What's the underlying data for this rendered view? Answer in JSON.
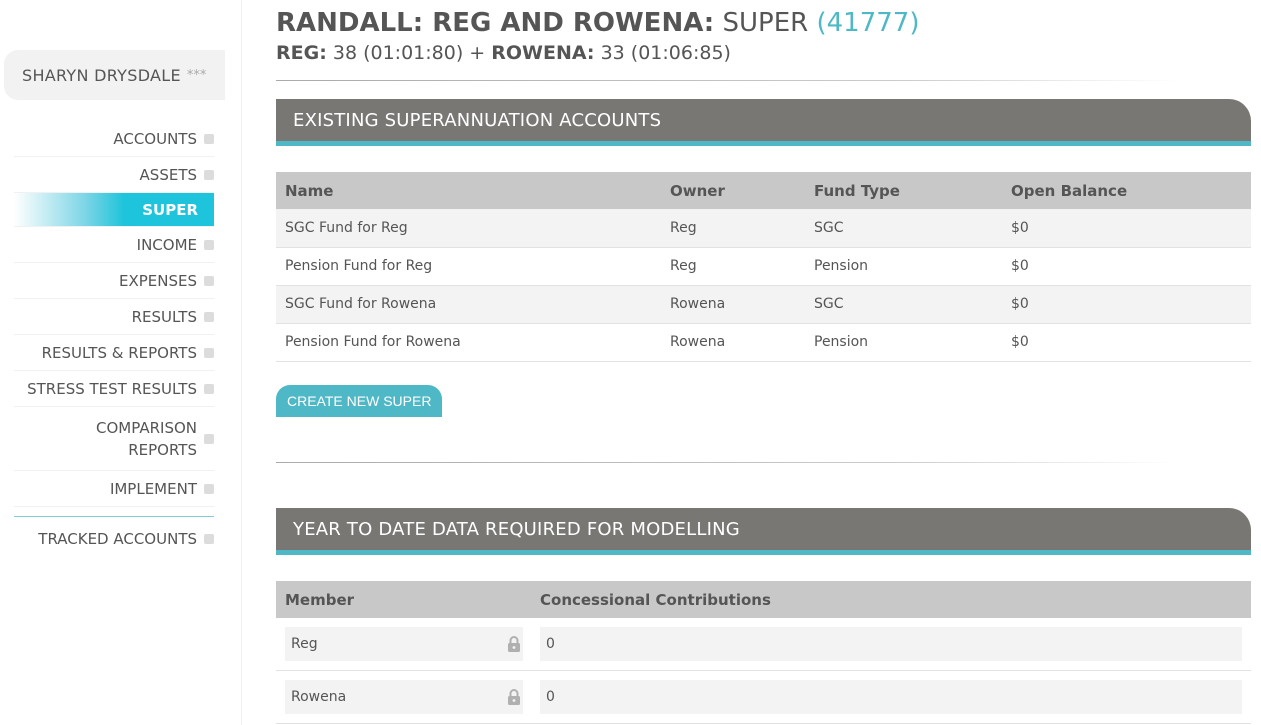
{
  "sidebar": {
    "user_name": "SHARYN DRYSDALE",
    "user_stars": "***",
    "items": [
      {
        "label": "ACCOUNTS"
      },
      {
        "label": "ASSETS"
      },
      {
        "label": "SUPER"
      },
      {
        "label": "INCOME"
      },
      {
        "label": "EXPENSES"
      },
      {
        "label": "RESULTS"
      },
      {
        "label": "RESULTS & REPORTS"
      },
      {
        "label": "STRESS TEST RESULTS"
      },
      {
        "label": "COMPARISON REPORTS"
      },
      {
        "label": "IMPLEMENT"
      },
      {
        "label": "TRACKED ACCOUNTS"
      }
    ],
    "active_item": "SUPER"
  },
  "header": {
    "client": "RANDALL: REG AND ROWENA:",
    "section": "SUPER",
    "id": "(41777)",
    "member1_label": "REG:",
    "member1_info": "38 (01:01:80)",
    "plus": "+",
    "member2_label": "ROWENA:",
    "member2_info": "33 (01:06:85)"
  },
  "accounts_panel": {
    "title": "EXISTING SUPERANNUATION ACCOUNTS",
    "columns": [
      "Name",
      "Owner",
      "Fund Type",
      "Open Balance"
    ],
    "rows": [
      {
        "name": "SGC Fund for Reg",
        "owner": "Reg",
        "fund_type": "SGC",
        "balance": "$0"
      },
      {
        "name": "Pension Fund for Reg",
        "owner": "Reg",
        "fund_type": "Pension",
        "balance": "$0"
      },
      {
        "name": "SGC Fund for Rowena",
        "owner": "Rowena",
        "fund_type": "SGC",
        "balance": "$0"
      },
      {
        "name": "Pension Fund for Rowena",
        "owner": "Rowena",
        "fund_type": "Pension",
        "balance": "$0"
      }
    ],
    "create_button": "CREATE NEW SUPER"
  },
  "ytd_panel": {
    "title": "YEAR TO DATE DATA REQUIRED FOR MODELLING",
    "columns": [
      "Member",
      "Concessional Contributions"
    ],
    "rows": [
      {
        "member": "Reg",
        "value": "0"
      },
      {
        "member": "Rowena",
        "value": "0"
      }
    ]
  },
  "colors": {
    "accent": "#4fb8c6",
    "active_nav": "#1ec4db",
    "panel_header": "#787774"
  }
}
